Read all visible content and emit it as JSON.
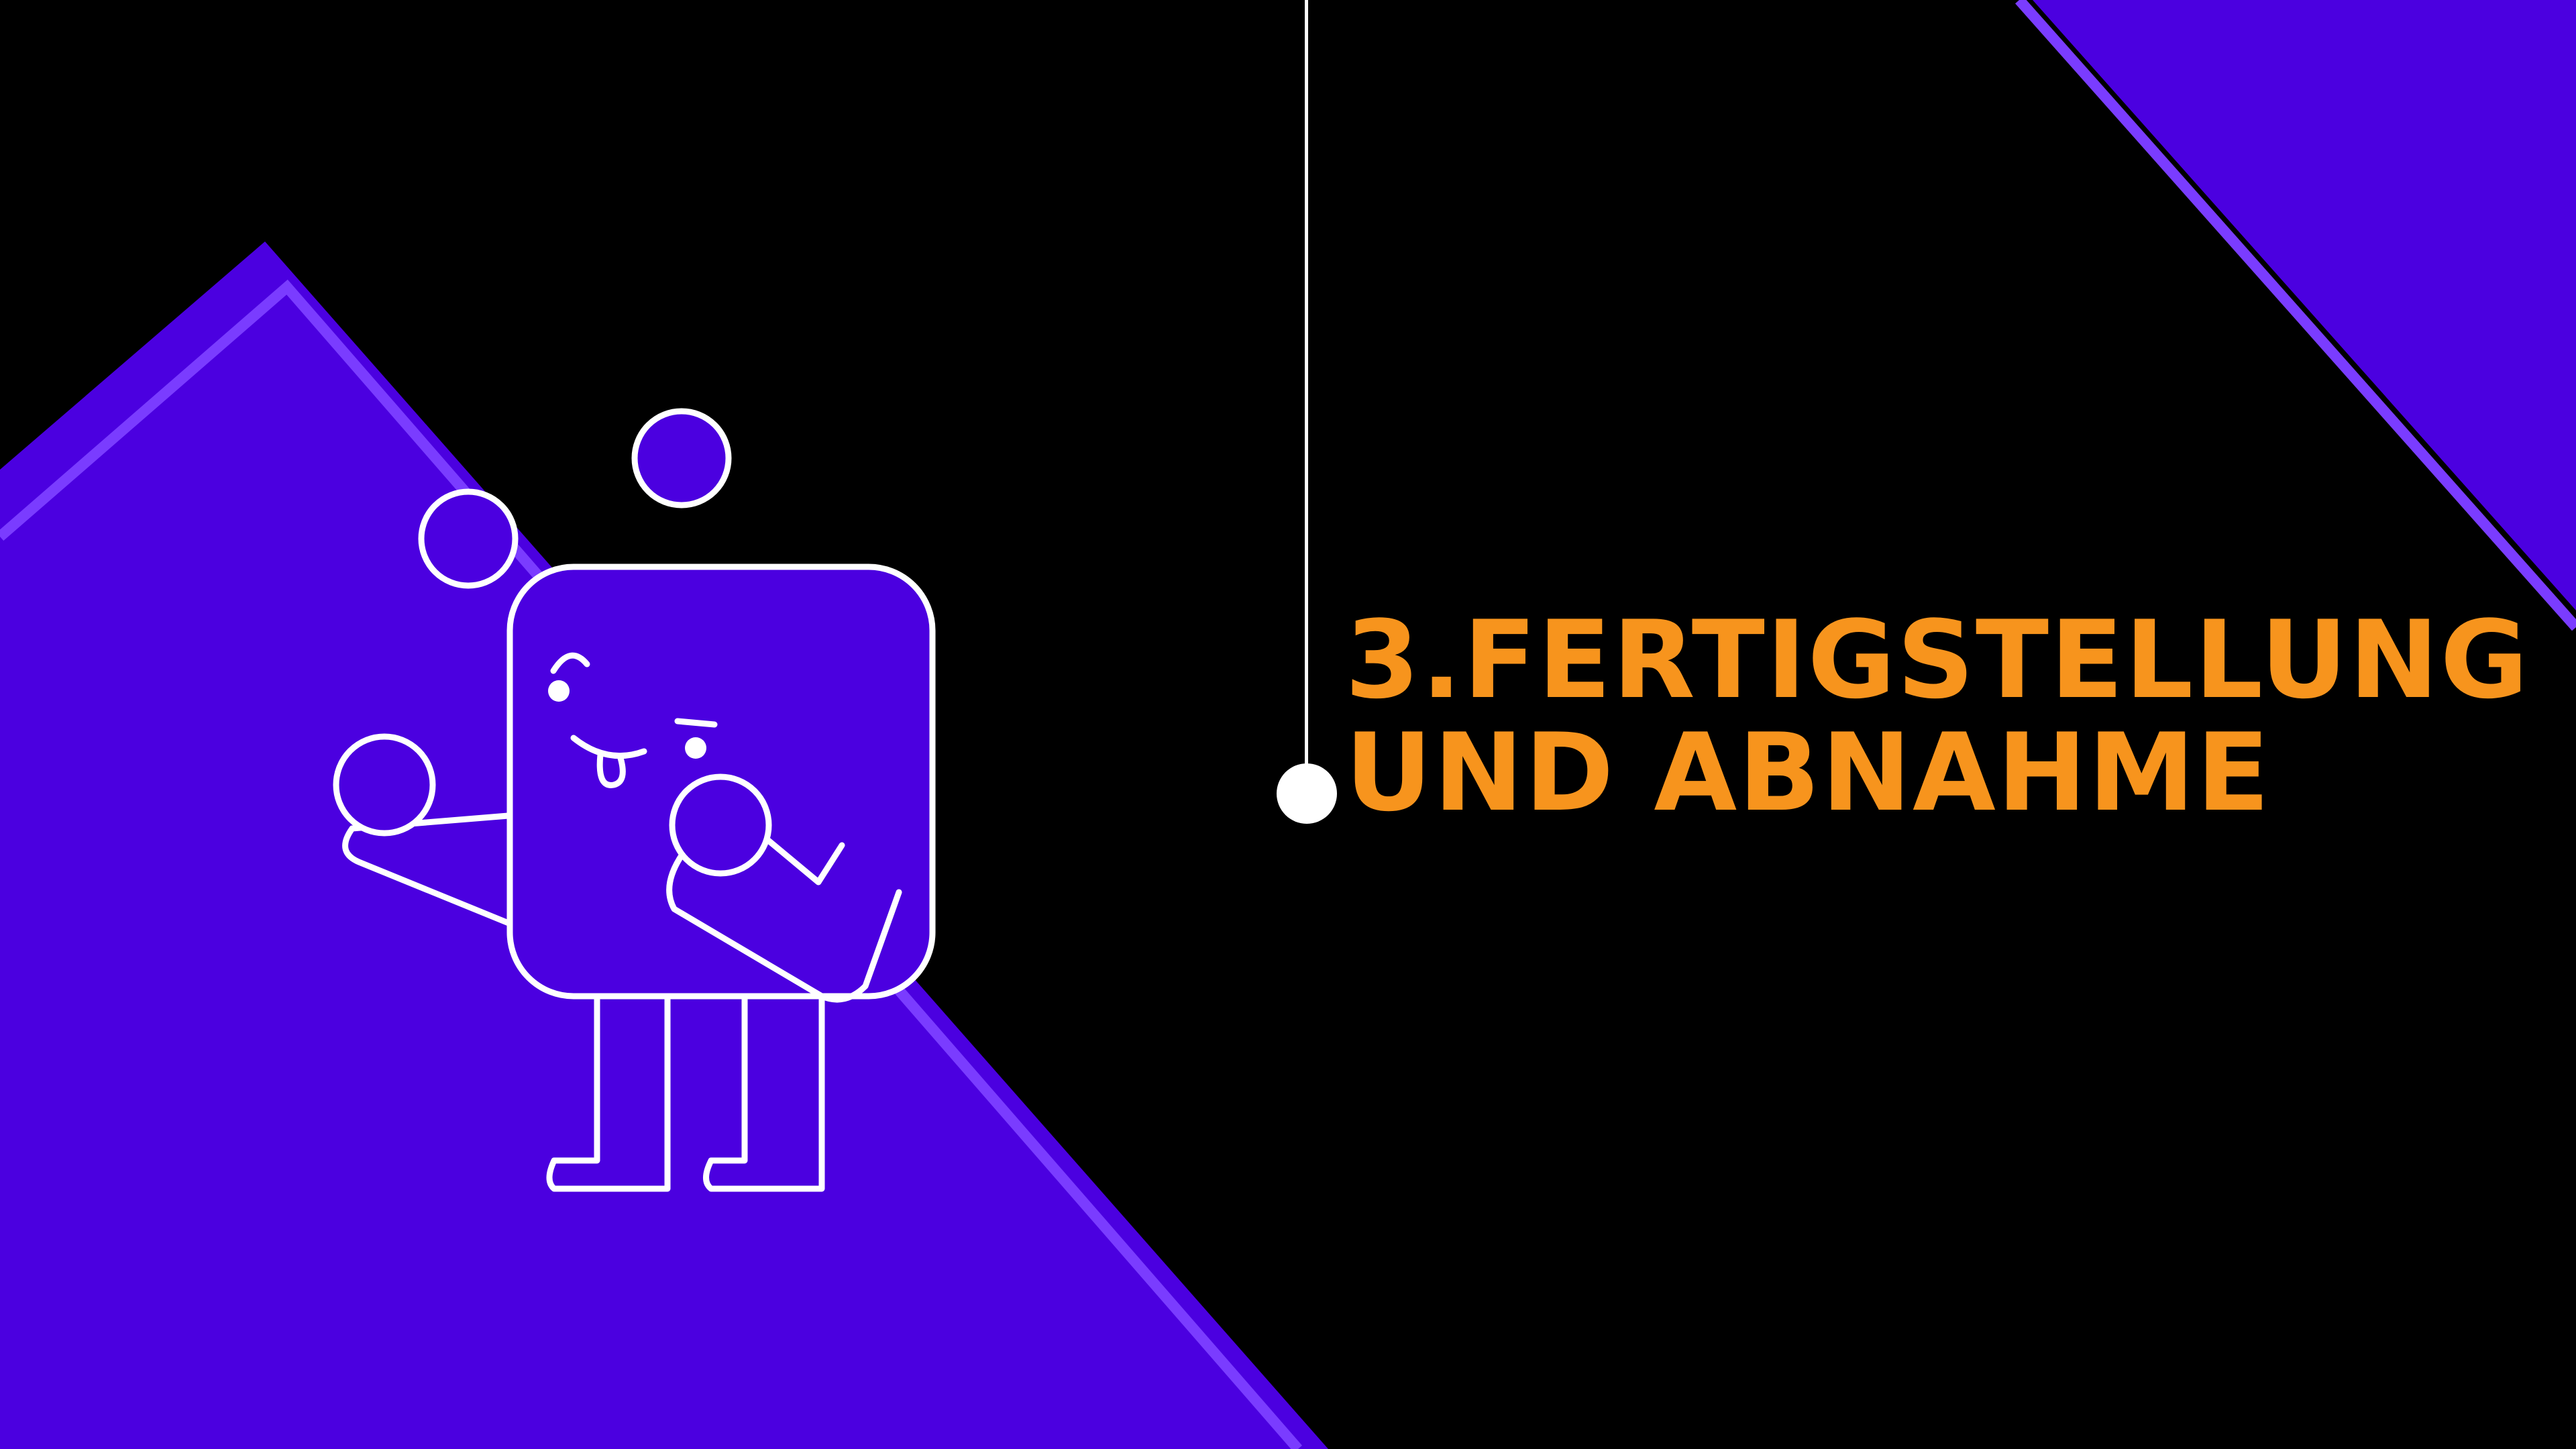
{
  "title": {
    "line1": "3.FERTIGSTELLUNG",
    "line2": "UND ABNAHME"
  },
  "colors": {
    "background": "#000000",
    "accent_purple": "#4b00e0",
    "accent_purple_stripe": "#7a3cff",
    "title_orange": "#f7941d",
    "line_white": "#ffffff"
  },
  "illustration": {
    "subject": "juggling-square-mascot",
    "icons": [
      "ball-icon",
      "mascot-face-icon"
    ]
  }
}
